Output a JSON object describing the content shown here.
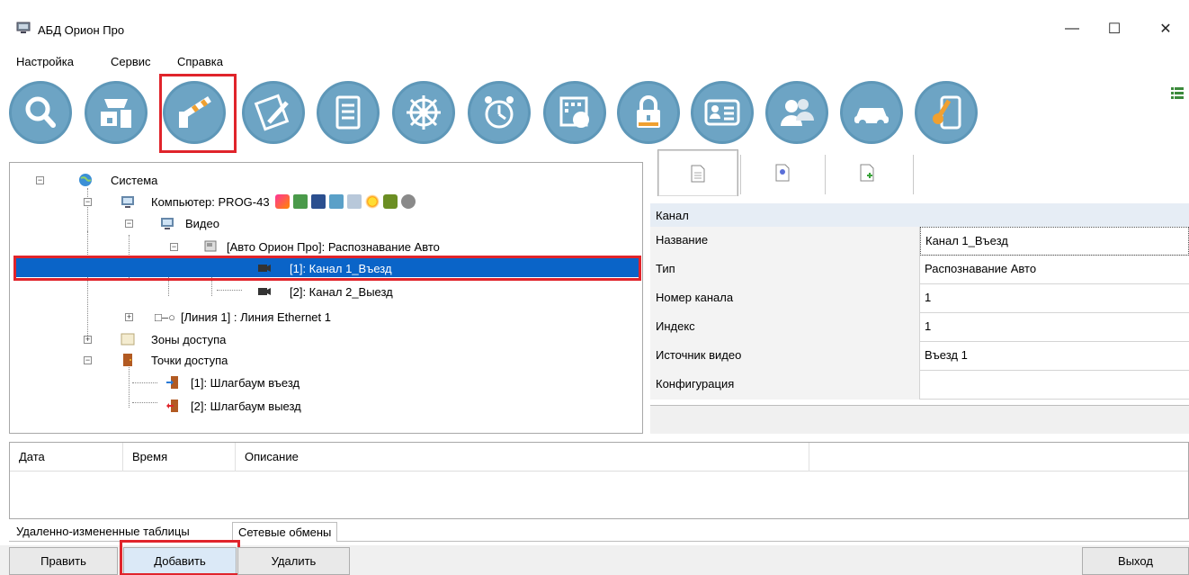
{
  "window": {
    "title": "АБД Орион Про",
    "minimize_glyph": "—",
    "maximize_glyph": "☐",
    "close_glyph": "✕"
  },
  "menu": {
    "items": [
      "Настройка",
      "Сервис",
      "Справка"
    ]
  },
  "toolbar": {
    "buttons": [
      {
        "icon": "search-icon"
      },
      {
        "icon": "devices-icon"
      },
      {
        "icon": "barrier-icon",
        "selected": true
      },
      {
        "icon": "edit-icon"
      },
      {
        "icon": "document-icon"
      },
      {
        "icon": "helm-icon"
      },
      {
        "icon": "alarm-clock-icon"
      },
      {
        "icon": "schedule-icon"
      },
      {
        "icon": "lock-icon"
      },
      {
        "icon": "employee-card-icon"
      },
      {
        "icon": "users-icon"
      },
      {
        "icon": "car-icon"
      },
      {
        "icon": "key-icon"
      }
    ],
    "accent_color": "#6da4c4",
    "highlight_color": "#e0242b"
  },
  "tree": {
    "items": [
      {
        "label": "Система"
      },
      {
        "label": "Компьютер: PROG-43"
      },
      {
        "label": "Видео"
      },
      {
        "label": "[Авто Орион Про]: Распознавание Авто"
      },
      {
        "label": "[1]: Канал 1_Въезд",
        "selected": true
      },
      {
        "label": "[2]: Канал 2_Выезд"
      },
      {
        "label": "[Линия 1] : Линия Ethernet 1"
      },
      {
        "label": "Зоны доступа"
      },
      {
        "label": "Точки доступа"
      },
      {
        "label": "[1]: Шлагбаум въезд"
      },
      {
        "label": "[2]: Шлагбаум выезд"
      }
    ],
    "selection_color": "#0a64c8"
  },
  "properties": {
    "header": "Канал",
    "rows": [
      {
        "name": "Название",
        "value": "Канал 1_Въезд"
      },
      {
        "name": "Тип",
        "value": "Распознавание Авто"
      },
      {
        "name": "Номер канала",
        "value": "1"
      },
      {
        "name": "Индекс",
        "value": "1"
      },
      {
        "name": "Источник видео",
        "value": "Въезд 1"
      },
      {
        "name": "Конфигурация",
        "value": ""
      }
    ]
  },
  "log": {
    "columns": [
      "Дата",
      "Время",
      "Описание"
    ]
  },
  "bottom_tabs": [
    "Удаленно-измененные таблицы",
    "Сетевые обмены"
  ],
  "buttons": {
    "edit": "Править",
    "add": "Добавить",
    "delete": "Удалить",
    "exit": "Выход"
  }
}
